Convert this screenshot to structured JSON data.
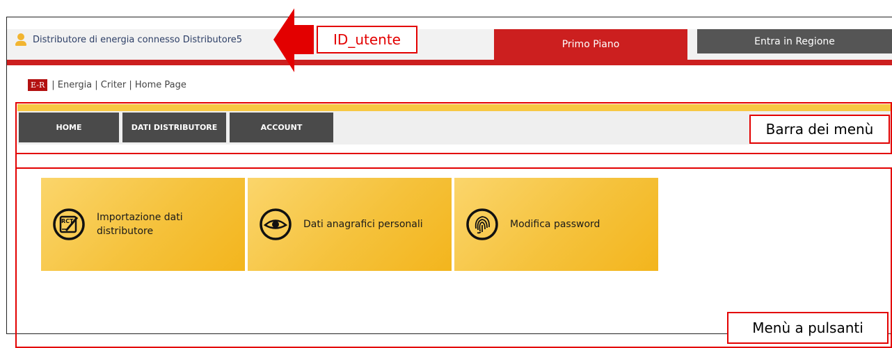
{
  "header": {
    "user_label": "Distributore di energia connesso Distributore5",
    "tabs": [
      "Primo Piano",
      "Entra in Regione"
    ]
  },
  "breadcrumb": {
    "logo": "E-R",
    "path": "| Energia | Criter | Home Page"
  },
  "nav": {
    "items": [
      "HOME",
      "DATI DISTRIBUTORE",
      "ACCOUNT"
    ]
  },
  "tiles": [
    {
      "label": "Importazione dati\ndistributore",
      "icon": "rct-edit-icon",
      "icon_text": "RCT"
    },
    {
      "label": "Dati anagrafici personali",
      "icon": "eye-icon"
    },
    {
      "label": "Modifica password",
      "icon": "fingerprint-icon"
    }
  ],
  "annotations": {
    "id_utente": "ID_utente",
    "barra_menu": "Barra dei menù",
    "menu_pulsanti": "Menù a pulsanti"
  },
  "colors": {
    "accent_red": "#cc1f1f",
    "annotation_red": "#e30000",
    "tile_gold": "#f5c23c",
    "nav_dark": "#4a4a4a"
  }
}
